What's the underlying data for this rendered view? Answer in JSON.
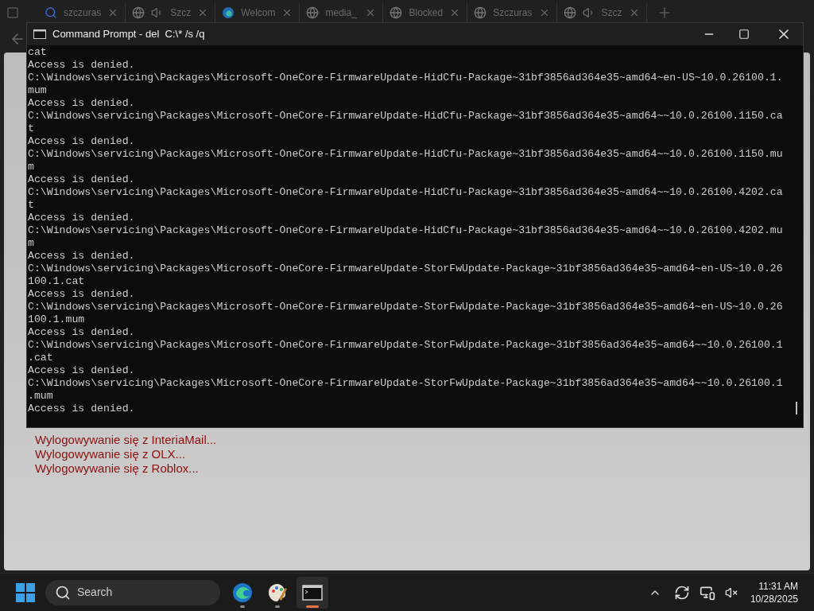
{
  "browser": {
    "tabs": [
      {
        "title": "szczuras",
        "kind": "search",
        "audio": false
      },
      {
        "title": "Szcz",
        "kind": "globe",
        "audio": true
      },
      {
        "title": "Welcom",
        "kind": "edge",
        "audio": false
      },
      {
        "title": "media_",
        "kind": "globe",
        "audio": false
      },
      {
        "title": "Blocked",
        "kind": "globe",
        "audio": false
      },
      {
        "title": "Szczuras",
        "kind": "globe",
        "audio": false
      },
      {
        "title": "Szcz",
        "kind": "globe",
        "audio": true
      }
    ],
    "page_lines": [
      "Wylogowywanie się z InteriaMail...",
      "Wylogowywanie się z OLX...",
      "Wylogowywanie się z Roblox..."
    ]
  },
  "console": {
    "title": "Command Prompt - del  C:\\* /s /q",
    "lines": [
      "cat",
      "Access is denied.",
      "C:\\Windows\\servicing\\Packages\\Microsoft-OneCore-FirmwareUpdate-HidCfu-Package~31bf3856ad364e35~amd64~en-US~10.0.26100.1.",
      "mum",
      "Access is denied.",
      "C:\\Windows\\servicing\\Packages\\Microsoft-OneCore-FirmwareUpdate-HidCfu-Package~31bf3856ad364e35~amd64~~10.0.26100.1150.ca",
      "t",
      "Access is denied.",
      "C:\\Windows\\servicing\\Packages\\Microsoft-OneCore-FirmwareUpdate-HidCfu-Package~31bf3856ad364e35~amd64~~10.0.26100.1150.mu",
      "m",
      "Access is denied.",
      "C:\\Windows\\servicing\\Packages\\Microsoft-OneCore-FirmwareUpdate-HidCfu-Package~31bf3856ad364e35~amd64~~10.0.26100.4202.ca",
      "t",
      "Access is denied.",
      "C:\\Windows\\servicing\\Packages\\Microsoft-OneCore-FirmwareUpdate-HidCfu-Package~31bf3856ad364e35~amd64~~10.0.26100.4202.mu",
      "m",
      "Access is denied.",
      "C:\\Windows\\servicing\\Packages\\Microsoft-OneCore-FirmwareUpdate-StorFwUpdate-Package~31bf3856ad364e35~amd64~en-US~10.0.26",
      "100.1.cat",
      "Access is denied.",
      "C:\\Windows\\servicing\\Packages\\Microsoft-OneCore-FirmwareUpdate-StorFwUpdate-Package~31bf3856ad364e35~amd64~en-US~10.0.26",
      "100.1.mum",
      "Access is denied.",
      "C:\\Windows\\servicing\\Packages\\Microsoft-OneCore-FirmwareUpdate-StorFwUpdate-Package~31bf3856ad364e35~amd64~~10.0.26100.1",
      ".cat",
      "Access is denied.",
      "C:\\Windows\\servicing\\Packages\\Microsoft-OneCore-FirmwareUpdate-StorFwUpdate-Package~31bf3856ad364e35~amd64~~10.0.26100.1",
      ".mum",
      "Access is denied."
    ]
  },
  "taskbar": {
    "search_placeholder": "Search",
    "apps": [
      {
        "kind": "edge",
        "running": true,
        "active": false
      },
      {
        "kind": "paint",
        "running": true,
        "active": false
      },
      {
        "kind": "terminal",
        "running": true,
        "active": true
      }
    ],
    "time": "11:31 AM",
    "date": "10/28/2025"
  }
}
